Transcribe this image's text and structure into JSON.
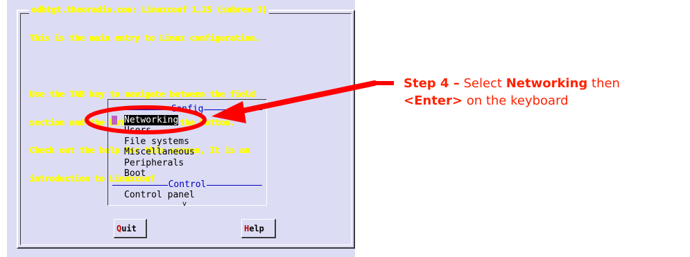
{
  "window": {
    "title": "odbtgt.theoradio.com: Linuxconf 1.25 (subrev 3)"
  },
  "intro_lines": [
    "This is the main entry to Linux configuration.",
    "",
    "Use the TAB key to navigate between the field",
    "section and the button bar at the bottom.",
    "Check out the help for this screen, It is an",
    "introduction to Linuxconf"
  ],
  "menu": {
    "config_header": "Config",
    "config_items": [
      "Networking",
      "Users",
      "File systems",
      "Miscellaneous",
      "Peripherals",
      "Boot"
    ],
    "selected_index": 0,
    "control_header": "Control",
    "control_items": [
      "Control panel"
    ],
    "scroll_indicator": "v"
  },
  "buttons": {
    "quit": {
      "hot": "Q",
      "rest": "uit"
    },
    "help": {
      "hot": "H",
      "rest": "elp"
    }
  },
  "callout": {
    "step": "Step 4 –",
    "text1": " Select ",
    "keyword": "Networking",
    "text2": " then",
    "key": "<Enter>",
    "text3": " on the keyboard"
  },
  "colors": {
    "screen_bg": "#dcdcf4",
    "title_text": "#ffff00",
    "header_text": "#0000c0",
    "annotation": "#ff0000",
    "callout_text": "#ff2200"
  }
}
